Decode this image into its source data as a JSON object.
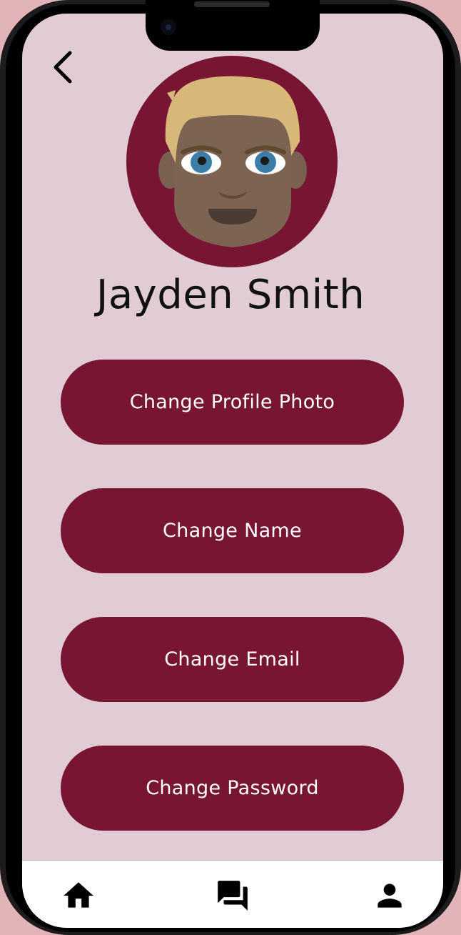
{
  "profile": {
    "name": "Jayden Smith"
  },
  "actions": [
    {
      "label": "Change Profile Photo"
    },
    {
      "label": "Change Name"
    },
    {
      "label": "Change Email"
    },
    {
      "label": "Change Password"
    }
  ],
  "nav": {
    "items": [
      {
        "icon": "home-icon"
      },
      {
        "icon": "chat-icon"
      },
      {
        "icon": "person-icon"
      }
    ]
  },
  "colors": {
    "accent": "#771533",
    "background": "#e1ccd5",
    "nav_background": "#ffffff"
  }
}
